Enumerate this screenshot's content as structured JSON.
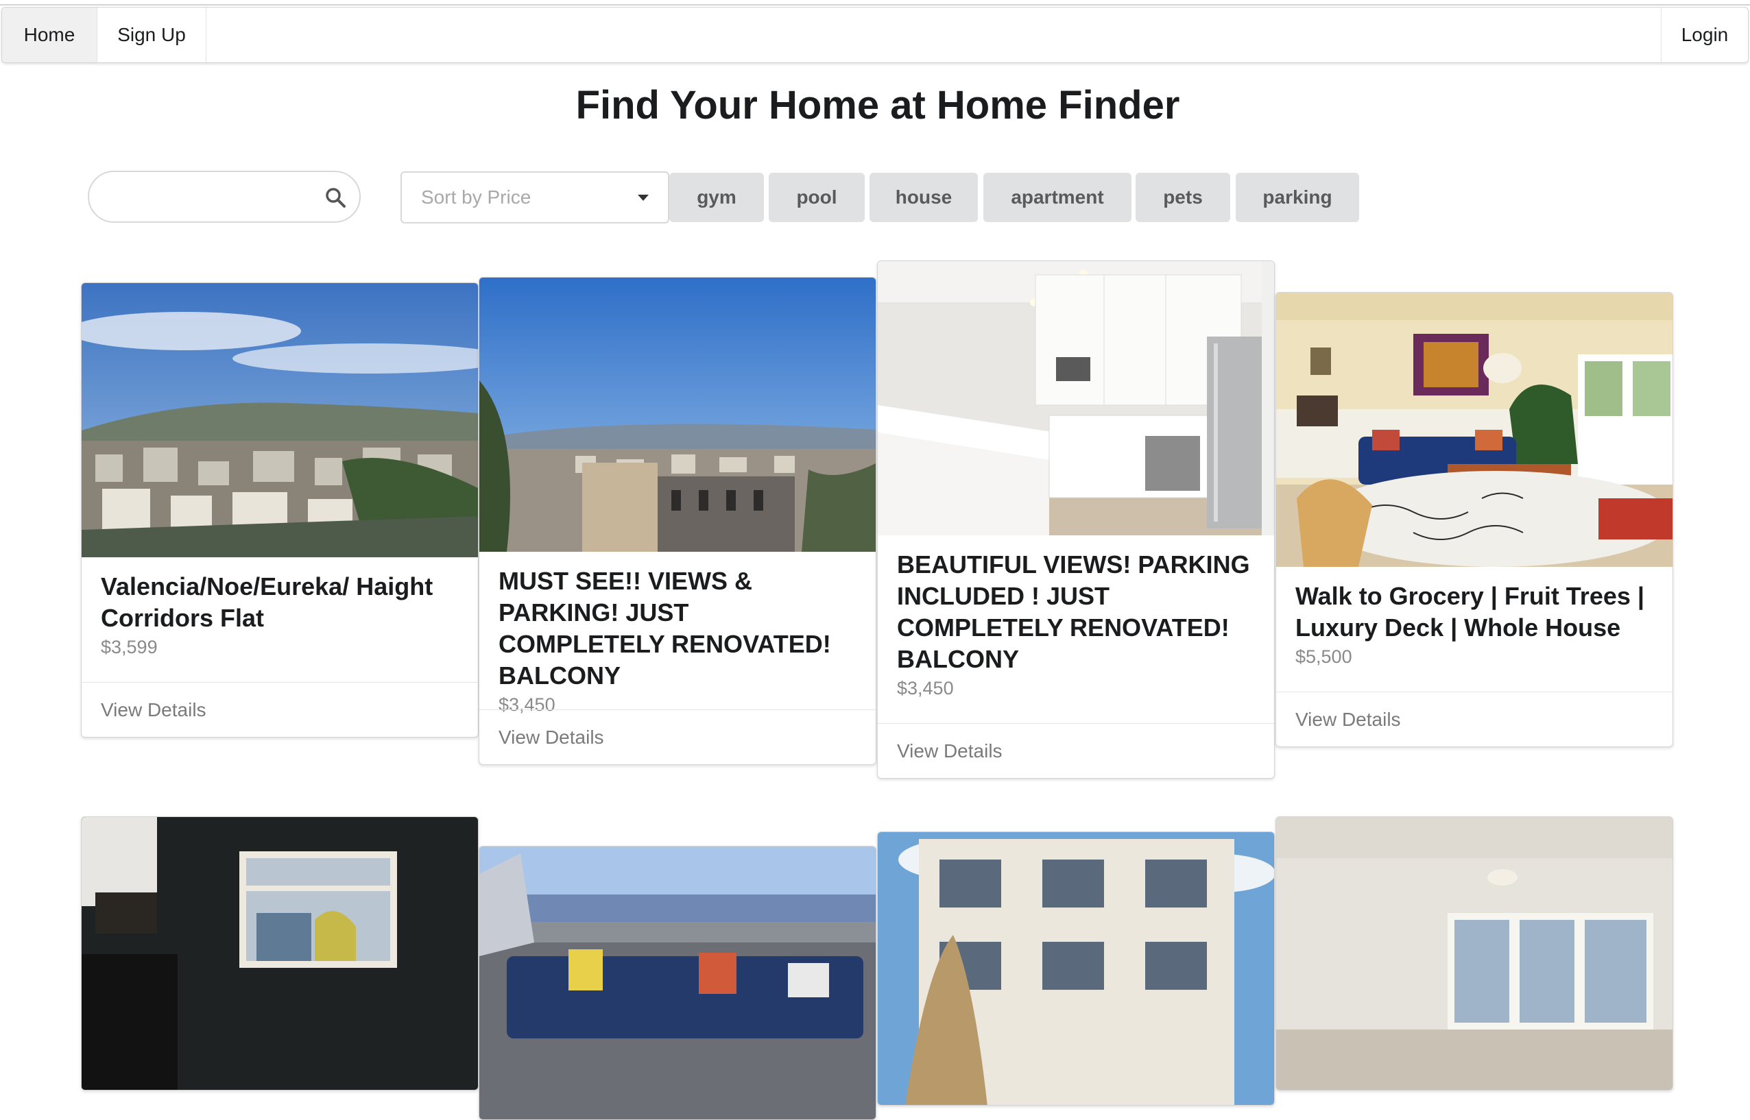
{
  "nav": {
    "home_label": "Home",
    "signup_label": "Sign Up",
    "login_label": "Login"
  },
  "page_title": "Find Your Home at Home Finder",
  "search": {
    "value": "",
    "placeholder": ""
  },
  "sort": {
    "label": "Sort by Price"
  },
  "tags": [
    "gym",
    "pool",
    "house",
    "apartment",
    "pets",
    "parking"
  ],
  "listings": [
    {
      "title": "Valencia/Noe/Eureka/ Haight Corridors Flat",
      "price": "$3,599",
      "action": "View Details",
      "photo": "hillside-city-view"
    },
    {
      "title": "MUST SEE!! VIEWS & PARKING! JUST COMPLETELY RENOVATED! BALCONY",
      "price": "$3,450",
      "action": "View Details",
      "photo": "bay-city-view"
    },
    {
      "title": "BEAUTIFUL VIEWS! PARKING INCLUDED ! JUST COMPLETELY RENOVATED! BALCONY",
      "price": "$3,450",
      "action": "View Details",
      "photo": "white-kitchen"
    },
    {
      "title": "Walk to Grocery | Fruit Trees | Luxury Deck | Whole House",
      "price": "$5,500",
      "action": "View Details",
      "photo": "living-room"
    },
    {
      "photo": "dark-room-window"
    },
    {
      "photo": "rooftop-deck"
    },
    {
      "photo": "building-facade"
    },
    {
      "photo": "empty-room"
    }
  ],
  "colors": {
    "tag_bg": "#e0e1e2",
    "tag_text": "#5a5a5a",
    "price_text": "#8a8a8a"
  }
}
